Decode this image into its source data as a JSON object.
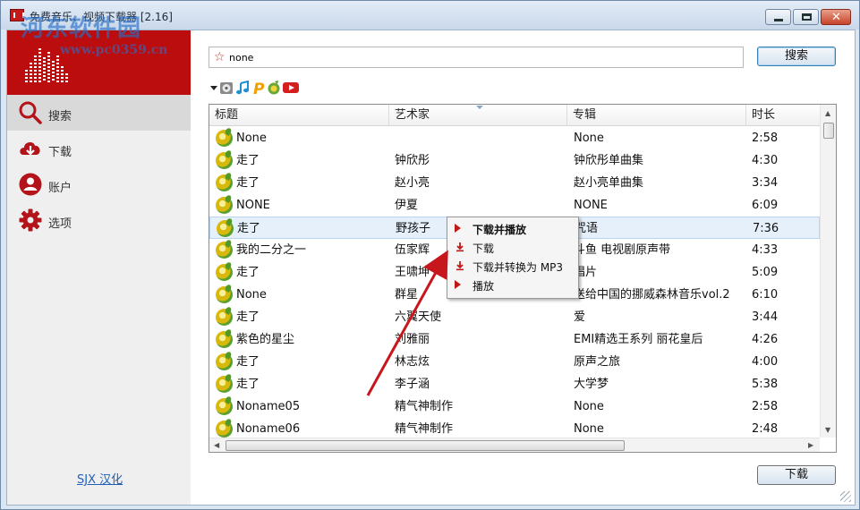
{
  "window": {
    "title": "免费音乐、视频下载器 [2.16]",
    "watermark": "河东软件园",
    "watermark_url": "www.pc0359.cn"
  },
  "sidebar": {
    "items": [
      {
        "label": "搜索",
        "icon": "search-icon",
        "active": true
      },
      {
        "label": "下载",
        "icon": "cloud-download-icon",
        "active": false
      },
      {
        "label": "账户",
        "icon": "user-icon",
        "active": false
      },
      {
        "label": "选项",
        "icon": "gear-icon",
        "active": false
      }
    ],
    "footer_link": "SJX 汉化"
  },
  "search": {
    "value": "none",
    "button_label": "搜索"
  },
  "sources": [
    "dropdown-arrow-icon",
    "disc-icon",
    "music-note-icon",
    "pandora-icon",
    "mp3-source-icon",
    "youtube-icon"
  ],
  "table": {
    "columns": [
      "标题",
      "艺术家",
      "专辑",
      "时长"
    ],
    "rows": [
      {
        "title": "None",
        "artist": "",
        "album": "None",
        "duration": "2:58"
      },
      {
        "title": "走了",
        "artist": "钟欣彤",
        "album": "钟欣彤单曲集",
        "duration": "4:30"
      },
      {
        "title": "走了",
        "artist": "赵小亮",
        "album": "赵小亮单曲集",
        "duration": "3:34"
      },
      {
        "title": "NONE",
        "artist": "伊夏",
        "album": "NONE",
        "duration": "6:09"
      },
      {
        "title": "走了",
        "artist": "野孩子",
        "album": "咒语",
        "duration": "7:36",
        "selected": true
      },
      {
        "title": "我的二分之一",
        "artist": "伍家辉",
        "album": "斗鱼 电视剧原声带",
        "duration": "4:33"
      },
      {
        "title": "走了",
        "artist": "王啸坤",
        "album": "唱片",
        "duration": "5:09"
      },
      {
        "title": "None",
        "artist": "群星",
        "album": "送给中国的挪威森林音乐vol.2",
        "duration": "6:10"
      },
      {
        "title": "走了",
        "artist": "六翼天使",
        "album": "爱",
        "duration": "3:44"
      },
      {
        "title": "紫色的星尘",
        "artist": "刘雅丽",
        "album": "EMI精选王系列 丽花皇后",
        "duration": "4:26"
      },
      {
        "title": "走了",
        "artist": "林志炫",
        "album": "原声之旅",
        "duration": "4:00"
      },
      {
        "title": "走了",
        "artist": "李子涵",
        "album": "大学梦",
        "duration": "5:38"
      },
      {
        "title": "Noname05",
        "artist": "精气神制作",
        "album": "None",
        "duration": "2:58"
      },
      {
        "title": "Noname06",
        "artist": "精气神制作",
        "album": "None",
        "duration": "2:48"
      }
    ]
  },
  "context_menu": {
    "items": [
      {
        "label": "下载并播放",
        "icon": "play-icon",
        "bold": true
      },
      {
        "label": "下载",
        "icon": "download-icon",
        "bold": false
      },
      {
        "label": "下载并转换为 MP3",
        "icon": "download-convert-icon",
        "bold": false
      },
      {
        "label": "播放",
        "icon": "play-icon",
        "bold": false
      }
    ]
  },
  "download_button_label": "下载",
  "colors": {
    "brand_red": "#bb0d0d",
    "annotation_arrow": "#c8161d",
    "selection": "#e5f0fb"
  }
}
